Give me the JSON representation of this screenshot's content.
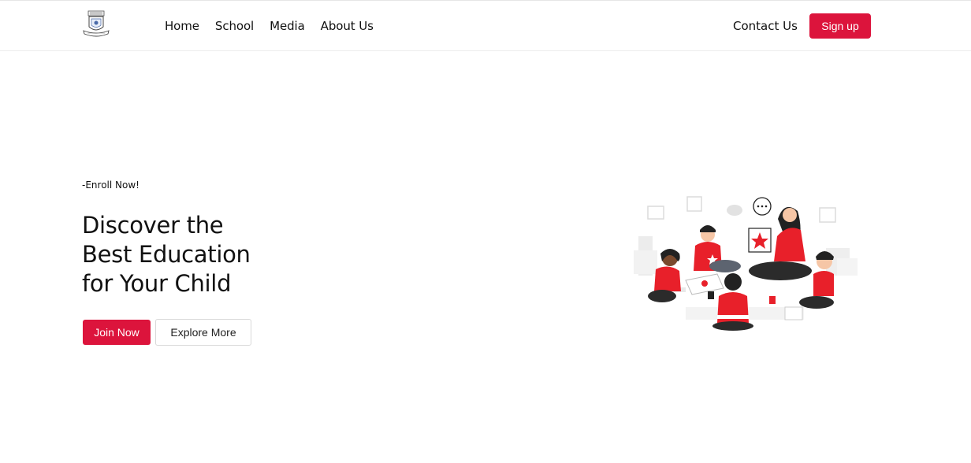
{
  "header": {
    "logo_icon": "school-crest-icon",
    "nav": [
      {
        "label": "Home"
      },
      {
        "label": "School"
      },
      {
        "label": "Media"
      },
      {
        "label": "About Us"
      }
    ],
    "contact_label": "Contact Us",
    "signup_label": "Sign up"
  },
  "hero": {
    "eyebrow": "-Enroll Now!",
    "title_lines": [
      "Discover the",
      "Best Education",
      "for Your Child"
    ],
    "join_label": "Join Now",
    "explore_label": "Explore More",
    "illustration_icon": "classroom-children-illustration"
  },
  "colors": {
    "accent": "#dc143c",
    "text": "#111111",
    "background": "#ffffff"
  }
}
